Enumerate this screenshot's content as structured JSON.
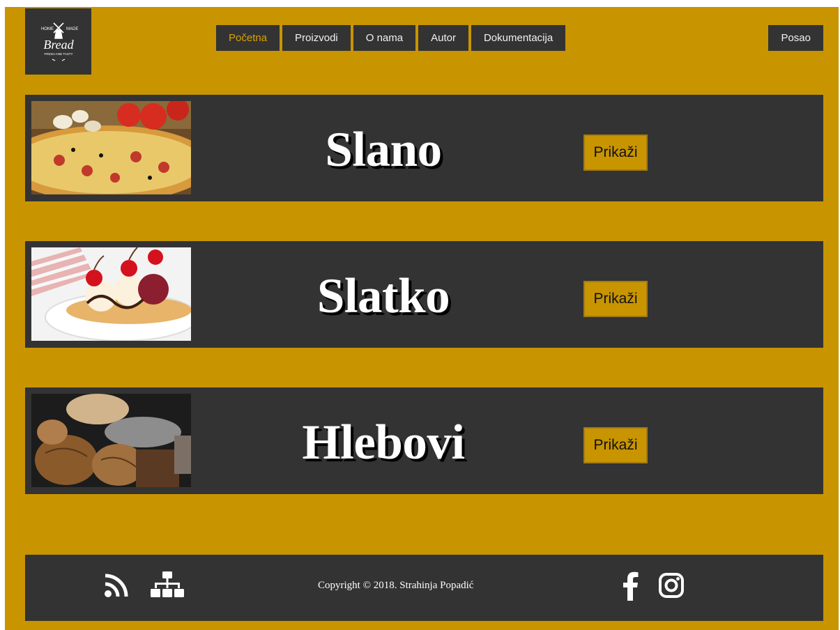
{
  "header": {
    "logo_name": "bread-logo",
    "nav": [
      {
        "label": "Početna",
        "active": true
      },
      {
        "label": "Proizvodi",
        "active": false
      },
      {
        "label": "O nama",
        "active": false
      },
      {
        "label": "Autor",
        "active": false
      },
      {
        "label": "Dokumentacija",
        "active": false
      }
    ],
    "job_label": "Posao"
  },
  "categories": [
    {
      "title": "Slano",
      "button_label": "Prikaži",
      "image": "pizza-image"
    },
    {
      "title": "Slatko",
      "button_label": "Prikaži",
      "image": "ice-cream-image"
    },
    {
      "title": "Hlebovi",
      "button_label": "Prikaži",
      "image": "bread-image"
    }
  ],
  "footer": {
    "copyright": "Copyright © 2018. Strahinja Popadić",
    "icons": [
      "rss-icon",
      "sitemap-icon",
      "facebook-icon",
      "instagram-icon"
    ]
  },
  "colors": {
    "background": "#c89400",
    "panel": "#333333",
    "active_nav": "#d9a300",
    "text_light": "#ffffff"
  }
}
